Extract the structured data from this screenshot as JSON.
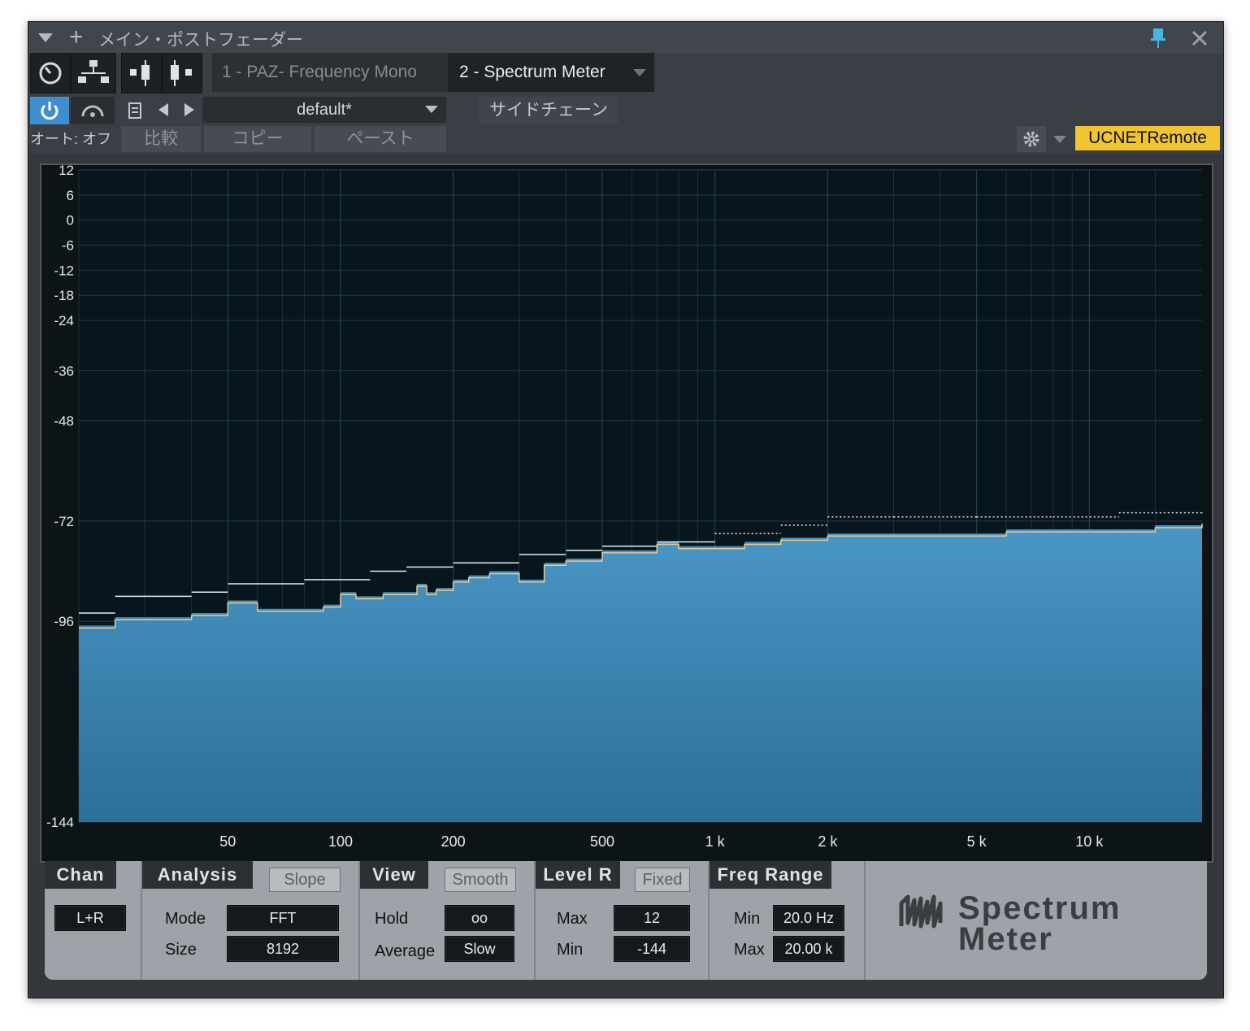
{
  "title_bar": {
    "title": "メイン・ポストフェーダー"
  },
  "plugin_tabs": [
    {
      "label": "1 - PAZ- Frequency Mono"
    },
    {
      "label": "2 - Spectrum Meter"
    }
  ],
  "toolbar": {
    "preset_name": "default*",
    "sidechain_label": "サイドチェーン",
    "auto_label": "オート: オフ",
    "compare_label": "比較",
    "copy_label": "コピー",
    "paste_label": "ペースト",
    "remote_label": "UCNETRemote"
  },
  "chart_data": {
    "type": "area",
    "title": "",
    "xlabel": "",
    "ylabel": "",
    "x_scale": "log",
    "xlim": [
      20,
      20000
    ],
    "ylim": [
      -144,
      12
    ],
    "grid": true,
    "x_ticks": [
      {
        "value": 50,
        "label": "50"
      },
      {
        "value": 100,
        "label": "100"
      },
      {
        "value": 200,
        "label": "200"
      },
      {
        "value": 500,
        "label": "500"
      },
      {
        "value": 1000,
        "label": "1 k"
      },
      {
        "value": 2000,
        "label": "2 k"
      },
      {
        "value": 5000,
        "label": "5 k"
      },
      {
        "value": 10000,
        "label": "10 k"
      }
    ],
    "y_ticks": [
      12,
      6,
      0,
      -6,
      -12,
      -18,
      -24,
      -36,
      -48,
      -72,
      -96,
      -144
    ],
    "series": [
      {
        "values_x": [
          20,
          25,
          30,
          35,
          40,
          45,
          50,
          55,
          60,
          70,
          80,
          90,
          100,
          110,
          120,
          130,
          150,
          160,
          170,
          180,
          200,
          220,
          250,
          280,
          300,
          350,
          400,
          450,
          500,
          600,
          700,
          800,
          1000,
          1200,
          1500,
          2000,
          2500,
          3000,
          4000,
          5000,
          6000,
          8000,
          10000,
          12000,
          15000,
          20000
        ],
        "values_y": [
          -97,
          -95,
          -95,
          -95,
          -94,
          -94,
          -91,
          -91,
          -93,
          -93,
          -93,
          -92,
          -89,
          -90,
          -90,
          -89,
          -89,
          -87,
          -89,
          -88,
          -86,
          -85,
          -84,
          -84,
          -86,
          -82,
          -81,
          -81,
          -79,
          -79,
          -77,
          -78,
          -78,
          -77,
          -76,
          -75,
          -75,
          -75,
          -75,
          -75,
          -74,
          -74,
          -74,
          -74,
          -73,
          -72
        ]
      },
      {
        "values_x": [
          20,
          25,
          40,
          50,
          60,
          80,
          100,
          120,
          150,
          200,
          250,
          300,
          400,
          500,
          700,
          1000,
          1500,
          2000,
          3000,
          5000,
          8000,
          12000,
          20000
        ],
        "values_y": [
          -94,
          -90,
          -89,
          -87,
          -87,
          -86,
          -86,
          -84,
          -83,
          -82,
          -82,
          -80,
          -79,
          -78,
          -77,
          -75,
          -73,
          -71,
          -71,
          -71,
          -71,
          -70,
          -70
        ]
      }
    ]
  },
  "controls": {
    "chan": {
      "title": "Chan",
      "value": "L+R"
    },
    "analysis": {
      "title": "Analysis",
      "slope_label": "Slope",
      "mode_label": "Mode",
      "mode_value": "FFT",
      "size_label": "Size",
      "size_value": "8192"
    },
    "view": {
      "title": "View",
      "smooth_label": "Smooth",
      "hold_label": "Hold",
      "hold_value": "oo",
      "average_label": "Average",
      "average_value": "Slow"
    },
    "level": {
      "title": "Level R",
      "fixed_label": "Fixed",
      "max_label": "Max",
      "max_value": "12",
      "min_label": "Min",
      "min_value": "-144"
    },
    "freq": {
      "title": "Freq Range",
      "min_label": "Min",
      "min_value": "20.0 Hz",
      "max_label": "Max",
      "max_value": "20.00 k"
    },
    "logo": {
      "line1": "Spectrum",
      "line2": "Meter"
    }
  }
}
